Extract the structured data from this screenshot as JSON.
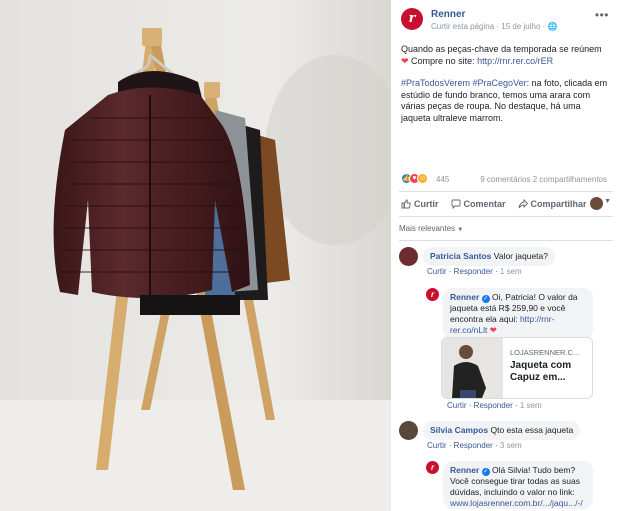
{
  "post": {
    "page_name": "Renner",
    "meta": "Curtir esta página · 15 de julho ·",
    "text_line1": "Quando as peças-chave da temporada se reúnem ",
    "text_line2": " Compre no site: ",
    "link": "http://rnr.rer.co/rER",
    "hashtags": "#PraTodosVerem #PraCegoVer",
    "description": ": na foto, clicada em estúdio de fundo branco, temos uma arara com várias peças de roupa. No destaque, há uma jaqueta ultraleve marrom."
  },
  "reactions": {
    "count": "445",
    "comments": "9 comentários",
    "shares": "2 compartilhamentos"
  },
  "actions": {
    "like": "Curtir",
    "comment": "Comentar",
    "share": "Compartilhar"
  },
  "sort_label": "Mais relevantes",
  "comments": [
    {
      "author": "Patricia Santos",
      "text": "Valor jaqueta?",
      "like": "Curtir",
      "reply": "Responder",
      "time": "1 sem"
    },
    {
      "author": "Renner",
      "text": "Oi, Patricia! O valor da jaqueta está R$ 259,90 e você encontra ela aqui: ",
      "link": "http://rnr-rer.co/nLlt",
      "like": "Curtir",
      "reply": "Responder",
      "time": "1 sem"
    },
    {
      "author": "Silvia Campos",
      "text": "Qto esta essa jaqueta",
      "like": "Curtir",
      "reply": "Responder",
      "time": "3 sem"
    },
    {
      "author": "Renner",
      "text": "Olá Silvia! Tudo bem? Você consegue tirar todas as suas dúvidas, incluindo o valor no link: ",
      "link": "www.lojasrenner.com.br/.../jaqu.../-/"
    }
  ],
  "link_card": {
    "domain": "LOJASRENNER.C...",
    "title": "Jaqueta com Capuz em..."
  },
  "colors": {
    "brand_red": "#c8102e",
    "link_blue": "#385898",
    "jacket_brown": "#4a1f22"
  }
}
